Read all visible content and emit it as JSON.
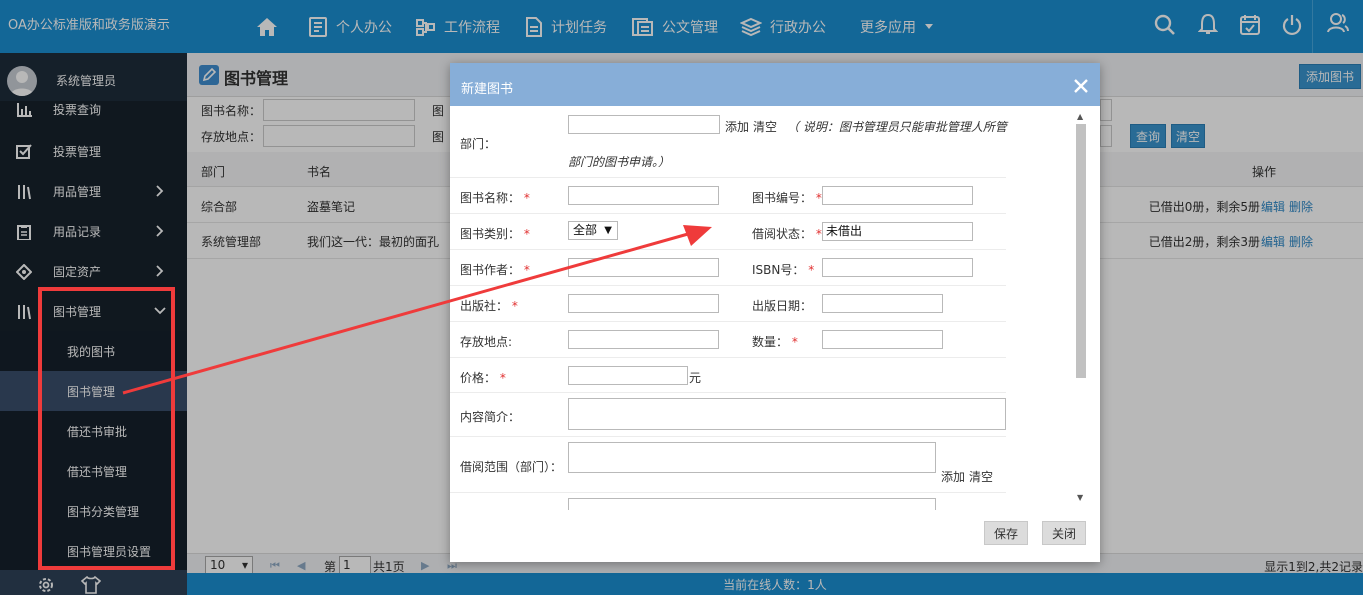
{
  "app_title": "OA办公标准版和政务版演示",
  "top_nav": {
    "home": "home",
    "items": [
      "个人办公",
      "工作流程",
      "计划任务",
      "公文管理",
      "行政办公",
      "更多应用"
    ]
  },
  "user": {
    "name": "系统管理员"
  },
  "sidebar": {
    "items": [
      "投票查询",
      "投票管理",
      "用品管理",
      "用品记录",
      "固定资产",
      "图书管理"
    ],
    "sub_items": [
      "我的图书",
      "图书管理",
      "借还书审批",
      "借还书管理",
      "图书分类管理",
      "图书管理员设置"
    ]
  },
  "page": {
    "title": "图书管理",
    "add_button": "添加图书",
    "filter_labels": [
      "图书名称：",
      "存放地点：",
      "图",
      "图"
    ],
    "query_button": "查询",
    "clear_button": "清空"
  },
  "table": {
    "headers": [
      "部门",
      "书名",
      "操作"
    ],
    "rows": [
      {
        "dept": "综合部",
        "name": "盗墓笔记",
        "status": "已借出0册，剩余5册",
        "edit": "编辑",
        "delete": "删除"
      },
      {
        "dept": "系统管理部",
        "name": "我们这一代：最初的面孔",
        "status": "已借出2册，剩余3册",
        "edit": "编辑",
        "delete": "删除"
      }
    ]
  },
  "pager": {
    "page_size": "10",
    "page_prefix": "第",
    "page_num": "1",
    "page_total": "共1页",
    "summary": "显示1到2,共2记录"
  },
  "footer": {
    "online": "当前在线人数：1人"
  },
  "modal": {
    "title": "新建图书",
    "fields": {
      "dept": "部门：",
      "add": "添加",
      "clear": "清空",
      "note": "（ 说明：图书管理员只能审批管理人所管",
      "note2": "部门的图书申请。）",
      "book_name": "图书名称：",
      "book_no": "图书编号：",
      "category": "图书类别：",
      "category_value": "全部",
      "borrow_status": "借阅状态：",
      "borrow_status_value": "未借出",
      "author": "图书作者：",
      "isbn": "ISBN号：",
      "publisher": "出版社：",
      "pub_date": "出版日期：",
      "location": "存放地点:",
      "quantity": "数量：",
      "price": "价格：",
      "price_unit": "元",
      "summary": "内容简介：",
      "scope": "借阅范围（部门）：",
      "scope_add": "添加",
      "scope_clear": "清空"
    },
    "save": "保存",
    "close": "关闭"
  },
  "colors": {
    "topbar": "#1b8fd1",
    "sidebar": "#17222c",
    "active_sub": "#3a4e6b",
    "modal_header": "#87aed8",
    "highlight_box": "#ef3b3b"
  }
}
